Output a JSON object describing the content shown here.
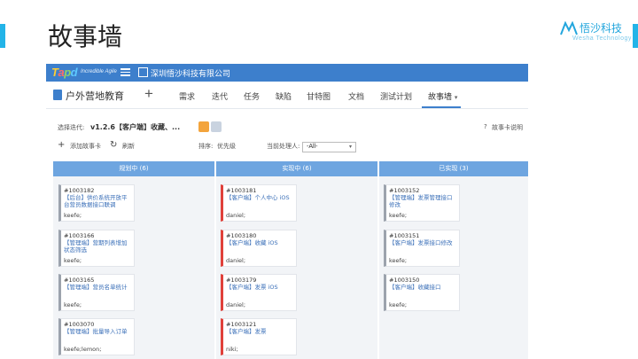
{
  "slide": {
    "title": "故事墙",
    "brand_name": "悟沙科技",
    "brand_sub": "Wesha Technology",
    "accent_color": "#23b4e8"
  },
  "app": {
    "logo": "Tapd",
    "logo_tagline": "Incredible Agile",
    "org_name": "深圳悟沙科技有限公司",
    "project_name": "户外营地教育",
    "nav": [
      "需求",
      "迭代",
      "任务",
      "缺陷",
      "甘特图",
      "文档",
      "测试计划",
      "故事墙"
    ],
    "active_nav": "故事墙",
    "filter": {
      "iteration_label": "选择迭代:",
      "iteration_value": "v1.2.6【客户端】收藏、...",
      "help_link": "故事卡说明",
      "add_story": "添加故事卡",
      "refresh": "刷新",
      "sort_label": "排序:",
      "sort_value": "优先级",
      "handler_label": "当前处理人:",
      "handler_value": "-All-"
    },
    "columns": [
      {
        "header": "规划中 (6)",
        "cards": [
          {
            "id": "#1003182",
            "title": "【后台】供价系统开放平台营员数据接口联调",
            "owner": "keefe;",
            "status": "gray"
          },
          {
            "id": "#1003166",
            "title": "【管理端】营期列表增加状态筛选",
            "owner": "keefe;",
            "status": "gray"
          },
          {
            "id": "#1003165",
            "title": "【管理端】营员名单统计",
            "owner": "keefe;",
            "status": "gray"
          },
          {
            "id": "#1003070",
            "title": "【管理端】批量导入订单",
            "owner": "keefe;lemon;",
            "status": "gray"
          }
        ]
      },
      {
        "header": "实现中 (6)",
        "cards": [
          {
            "id": "#1003181",
            "title": "【客户端】个人中心 iOS",
            "owner": "daniel;",
            "status": "red"
          },
          {
            "id": "#1003180",
            "title": "【客户端】收藏 iOS",
            "owner": "daniel;",
            "status": "red"
          },
          {
            "id": "#1003179",
            "title": "【客户端】发票 iOS",
            "owner": "daniel;",
            "status": "red"
          },
          {
            "id": "#1003121",
            "title": "【客户端】发票",
            "owner": "niki;",
            "status": "red"
          }
        ]
      },
      {
        "header": "已实现 (3)",
        "cards": [
          {
            "id": "#1003152",
            "title": "【管理端】发票管理接口修改",
            "owner": "keefe;",
            "status": "gray"
          },
          {
            "id": "#1003151",
            "title": "【客户端】发票接口修改",
            "owner": "keefe;",
            "status": "gray"
          },
          {
            "id": "#1003150",
            "title": "【客户端】收藏接口",
            "owner": "keefe;",
            "status": "gray"
          }
        ]
      }
    ]
  }
}
